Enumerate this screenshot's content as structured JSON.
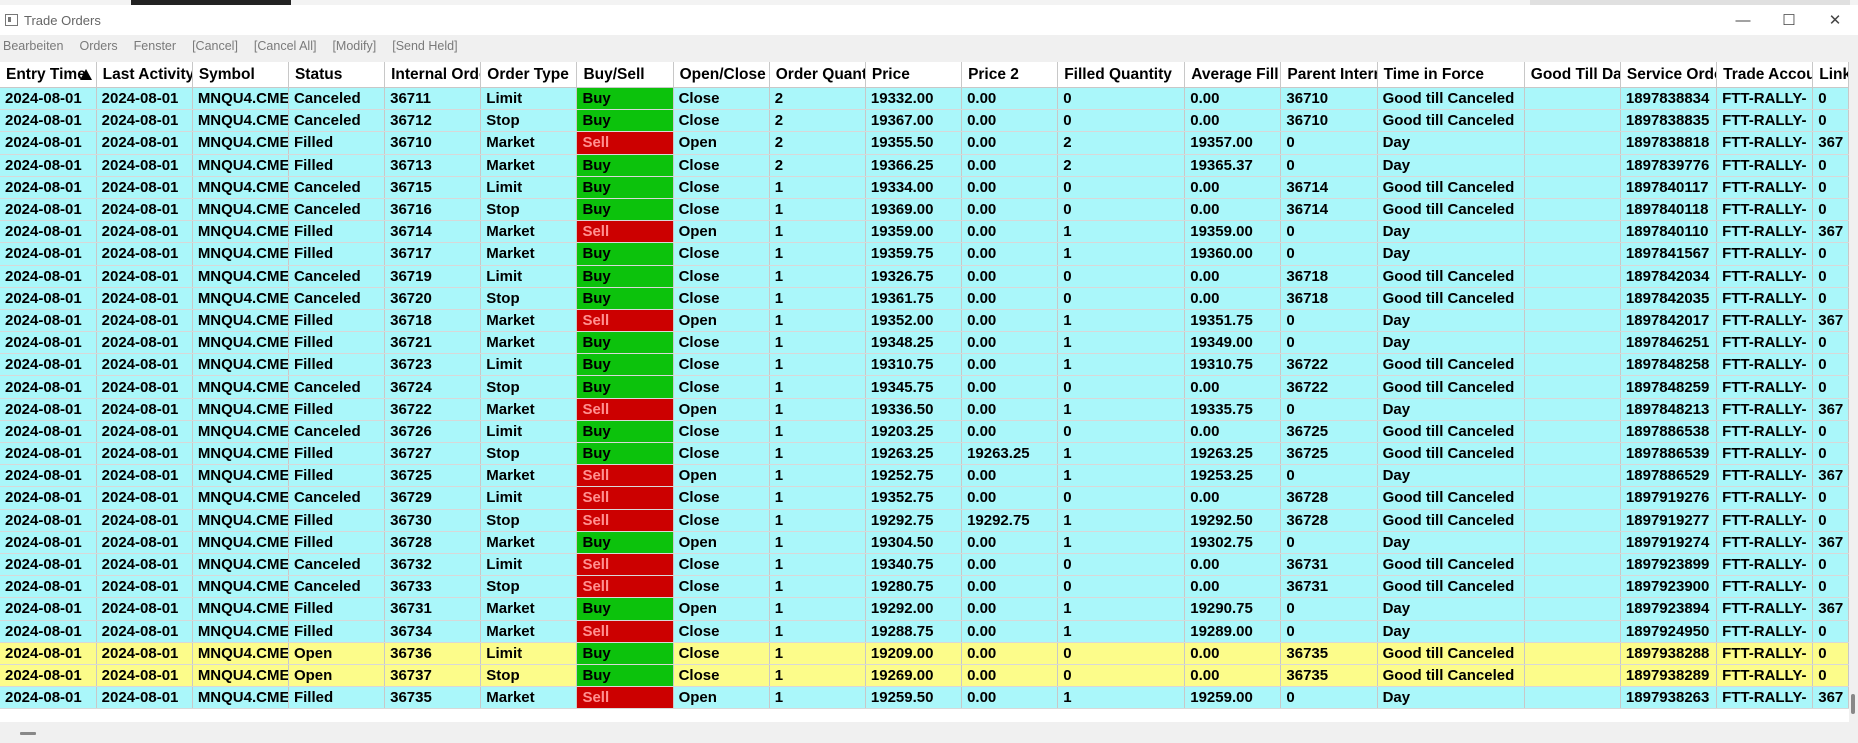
{
  "window": {
    "title": "Trade Orders",
    "controls": [
      "minimize-icon",
      "maximize-icon",
      "close-icon"
    ]
  },
  "menu": [
    "Bearbeiten",
    "Orders",
    "Fenster",
    "[Cancel]",
    "[Cancel All]",
    "[Modify]",
    "[Send Held]"
  ],
  "colors": {
    "row_default": "#aaf7fa",
    "row_open": "#fcfc8a",
    "buy": "#0cc20c",
    "sell": "#cc0000"
  },
  "grid": {
    "sorted_column": "Entry Time",
    "sort_direction": "ascending",
    "columns": [
      "Entry Time",
      "Last Activity",
      "Symbol",
      "Status",
      "Internal Order",
      "Order Type",
      "Buy/Sell",
      "Open/Close",
      "Order Quantity",
      "Price",
      "Price 2",
      "Filled Quantity",
      "Average Fill",
      "Parent Internal",
      "Time in Force",
      "Good Till Date",
      "Service Order",
      "Trade Account",
      "Link"
    ],
    "rows": [
      [
        "2024-08-01",
        "2024-08-01",
        "MNQU4.CME",
        "Canceled",
        "36711",
        "Limit",
        "Buy",
        "Close",
        "2",
        "19332.00",
        "0.00",
        "0",
        "0.00",
        "36710",
        "Good till Canceled",
        "",
        "1897838834",
        "FTT-RALLY-",
        "0"
      ],
      [
        "2024-08-01",
        "2024-08-01",
        "MNQU4.CME",
        "Canceled",
        "36712",
        "Stop",
        "Buy",
        "Close",
        "2",
        "19367.00",
        "0.00",
        "0",
        "0.00",
        "36710",
        "Good till Canceled",
        "",
        "1897838835",
        "FTT-RALLY-",
        "0"
      ],
      [
        "2024-08-01",
        "2024-08-01",
        "MNQU4.CME",
        "Filled",
        "36710",
        "Market",
        "Sell",
        "Open",
        "2",
        "19355.50",
        "0.00",
        "2",
        "19357.00",
        "0",
        "Day",
        "",
        "1897838818",
        "FTT-RALLY-",
        "367"
      ],
      [
        "2024-08-01",
        "2024-08-01",
        "MNQU4.CME",
        "Filled",
        "36713",
        "Market",
        "Buy",
        "Close",
        "2",
        "19366.25",
        "0.00",
        "2",
        "19365.37",
        "0",
        "Day",
        "",
        "1897839776",
        "FTT-RALLY-",
        "0"
      ],
      [
        "2024-08-01",
        "2024-08-01",
        "MNQU4.CME",
        "Canceled",
        "36715",
        "Limit",
        "Buy",
        "Close",
        "1",
        "19334.00",
        "0.00",
        "0",
        "0.00",
        "36714",
        "Good till Canceled",
        "",
        "1897840117",
        "FTT-RALLY-",
        "0"
      ],
      [
        "2024-08-01",
        "2024-08-01",
        "MNQU4.CME",
        "Canceled",
        "36716",
        "Stop",
        "Buy",
        "Close",
        "1",
        "19369.00",
        "0.00",
        "0",
        "0.00",
        "36714",
        "Good till Canceled",
        "",
        "1897840118",
        "FTT-RALLY-",
        "0"
      ],
      [
        "2024-08-01",
        "2024-08-01",
        "MNQU4.CME",
        "Filled",
        "36714",
        "Market",
        "Sell",
        "Open",
        "1",
        "19359.00",
        "0.00",
        "1",
        "19359.00",
        "0",
        "Day",
        "",
        "1897840110",
        "FTT-RALLY-",
        "367"
      ],
      [
        "2024-08-01",
        "2024-08-01",
        "MNQU4.CME",
        "Filled",
        "36717",
        "Market",
        "Buy",
        "Close",
        "1",
        "19359.75",
        "0.00",
        "1",
        "19360.00",
        "0",
        "Day",
        "",
        "1897841567",
        "FTT-RALLY-",
        "0"
      ],
      [
        "2024-08-01",
        "2024-08-01",
        "MNQU4.CME",
        "Canceled",
        "36719",
        "Limit",
        "Buy",
        "Close",
        "1",
        "19326.75",
        "0.00",
        "0",
        "0.00",
        "36718",
        "Good till Canceled",
        "",
        "1897842034",
        "FTT-RALLY-",
        "0"
      ],
      [
        "2024-08-01",
        "2024-08-01",
        "MNQU4.CME",
        "Canceled",
        "36720",
        "Stop",
        "Buy",
        "Close",
        "1",
        "19361.75",
        "0.00",
        "0",
        "0.00",
        "36718",
        "Good till Canceled",
        "",
        "1897842035",
        "FTT-RALLY-",
        "0"
      ],
      [
        "2024-08-01",
        "2024-08-01",
        "MNQU4.CME",
        "Filled",
        "36718",
        "Market",
        "Sell",
        "Open",
        "1",
        "19352.00",
        "0.00",
        "1",
        "19351.75",
        "0",
        "Day",
        "",
        "1897842017",
        "FTT-RALLY-",
        "367"
      ],
      [
        "2024-08-01",
        "2024-08-01",
        "MNQU4.CME",
        "Filled",
        "36721",
        "Market",
        "Buy",
        "Close",
        "1",
        "19348.25",
        "0.00",
        "1",
        "19349.00",
        "0",
        "Day",
        "",
        "1897846251",
        "FTT-RALLY-",
        "0"
      ],
      [
        "2024-08-01",
        "2024-08-01",
        "MNQU4.CME",
        "Filled",
        "36723",
        "Limit",
        "Buy",
        "Close",
        "1",
        "19310.75",
        "0.00",
        "1",
        "19310.75",
        "36722",
        "Good till Canceled",
        "",
        "1897848258",
        "FTT-RALLY-",
        "0"
      ],
      [
        "2024-08-01",
        "2024-08-01",
        "MNQU4.CME",
        "Canceled",
        "36724",
        "Stop",
        "Buy",
        "Close",
        "1",
        "19345.75",
        "0.00",
        "0",
        "0.00",
        "36722",
        "Good till Canceled",
        "",
        "1897848259",
        "FTT-RALLY-",
        "0"
      ],
      [
        "2024-08-01",
        "2024-08-01",
        "MNQU4.CME",
        "Filled",
        "36722",
        "Market",
        "Sell",
        "Open",
        "1",
        "19336.50",
        "0.00",
        "1",
        "19335.75",
        "0",
        "Day",
        "",
        "1897848213",
        "FTT-RALLY-",
        "367"
      ],
      [
        "2024-08-01",
        "2024-08-01",
        "MNQU4.CME",
        "Canceled",
        "36726",
        "Limit",
        "Buy",
        "Close",
        "1",
        "19203.25",
        "0.00",
        "0",
        "0.00",
        "36725",
        "Good till Canceled",
        "",
        "1897886538",
        "FTT-RALLY-",
        "0"
      ],
      [
        "2024-08-01",
        "2024-08-01",
        "MNQU4.CME",
        "Filled",
        "36727",
        "Stop",
        "Buy",
        "Close",
        "1",
        "19263.25",
        "19263.25",
        "1",
        "19263.25",
        "36725",
        "Good till Canceled",
        "",
        "1897886539",
        "FTT-RALLY-",
        "0"
      ],
      [
        "2024-08-01",
        "2024-08-01",
        "MNQU4.CME",
        "Filled",
        "36725",
        "Market",
        "Sell",
        "Open",
        "1",
        "19252.75",
        "0.00",
        "1",
        "19253.25",
        "0",
        "Day",
        "",
        "1897886529",
        "FTT-RALLY-",
        "367"
      ],
      [
        "2024-08-01",
        "2024-08-01",
        "MNQU4.CME",
        "Canceled",
        "36729",
        "Limit",
        "Sell",
        "Close",
        "1",
        "19352.75",
        "0.00",
        "0",
        "0.00",
        "36728",
        "Good till Canceled",
        "",
        "1897919276",
        "FTT-RALLY-",
        "0"
      ],
      [
        "2024-08-01",
        "2024-08-01",
        "MNQU4.CME",
        "Filled",
        "36730",
        "Stop",
        "Sell",
        "Close",
        "1",
        "19292.75",
        "19292.75",
        "1",
        "19292.50",
        "36728",
        "Good till Canceled",
        "",
        "1897919277",
        "FTT-RALLY-",
        "0"
      ],
      [
        "2024-08-01",
        "2024-08-01",
        "MNQU4.CME",
        "Filled",
        "36728",
        "Market",
        "Buy",
        "Open",
        "1",
        "19304.50",
        "0.00",
        "1",
        "19302.75",
        "0",
        "Day",
        "",
        "1897919274",
        "FTT-RALLY-",
        "367"
      ],
      [
        "2024-08-01",
        "2024-08-01",
        "MNQU4.CME",
        "Canceled",
        "36732",
        "Limit",
        "Sell",
        "Close",
        "1",
        "19340.75",
        "0.00",
        "0",
        "0.00",
        "36731",
        "Good till Canceled",
        "",
        "1897923899",
        "FTT-RALLY-",
        "0"
      ],
      [
        "2024-08-01",
        "2024-08-01",
        "MNQU4.CME",
        "Canceled",
        "36733",
        "Stop",
        "Sell",
        "Close",
        "1",
        "19280.75",
        "0.00",
        "0",
        "0.00",
        "36731",
        "Good till Canceled",
        "",
        "1897923900",
        "FTT-RALLY-",
        "0"
      ],
      [
        "2024-08-01",
        "2024-08-01",
        "MNQU4.CME",
        "Filled",
        "36731",
        "Market",
        "Buy",
        "Open",
        "1",
        "19292.00",
        "0.00",
        "1",
        "19290.75",
        "0",
        "Day",
        "",
        "1897923894",
        "FTT-RALLY-",
        "367"
      ],
      [
        "2024-08-01",
        "2024-08-01",
        "MNQU4.CME",
        "Filled",
        "36734",
        "Market",
        "Sell",
        "Close",
        "1",
        "19288.75",
        "0.00",
        "1",
        "19289.00",
        "0",
        "Day",
        "",
        "1897924950",
        "FTT-RALLY-",
        "0"
      ],
      [
        "2024-08-01",
        "2024-08-01",
        "MNQU4.CME",
        "Open",
        "36736",
        "Limit",
        "Buy",
        "Close",
        "1",
        "19209.00",
        "0.00",
        "0",
        "0.00",
        "36735",
        "Good till Canceled",
        "",
        "1897938288",
        "FTT-RALLY-",
        "0"
      ],
      [
        "2024-08-01",
        "2024-08-01",
        "MNQU4.CME",
        "Open",
        "36737",
        "Stop",
        "Buy",
        "Close",
        "1",
        "19269.00",
        "0.00",
        "0",
        "0.00",
        "36735",
        "Good till Canceled",
        "",
        "1897938289",
        "FTT-RALLY-",
        "0"
      ],
      [
        "2024-08-01",
        "2024-08-01",
        "MNQU4.CME",
        "Filled",
        "36735",
        "Market",
        "Sell",
        "Open",
        "1",
        "19259.50",
        "0.00",
        "1",
        "19259.00",
        "0",
        "Day",
        "",
        "1897938263",
        "FTT-RALLY-",
        "367"
      ]
    ]
  }
}
